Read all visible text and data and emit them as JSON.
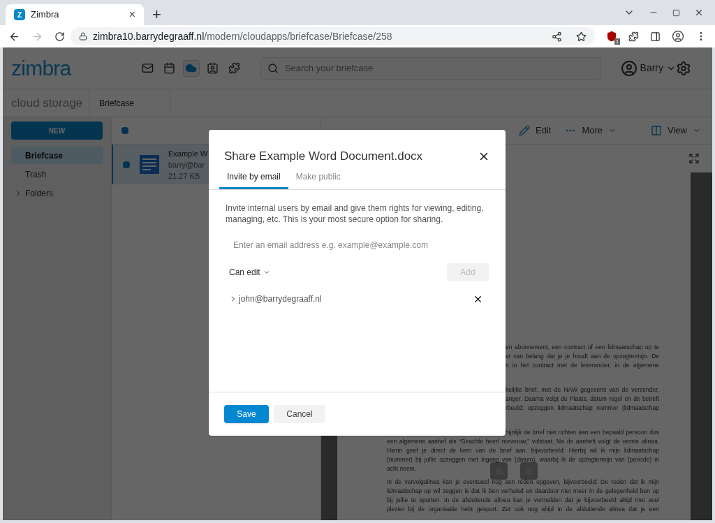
{
  "browser": {
    "tab": {
      "favicon_letter": "Z",
      "title": "Zimbra",
      "close": "×"
    },
    "new_tab": "+",
    "url_host": "zimbra10.barrydegraaff.nl",
    "url_path": "/modern/cloudapps/briefcase/Briefcase/258",
    "extension_badge": "1"
  },
  "app": {
    "logo": "zimbra",
    "nav_icons": [
      {
        "kind": "mail",
        "selected": false
      },
      {
        "kind": "calendar",
        "selected": false
      },
      {
        "kind": "cloud",
        "selected": true
      },
      {
        "kind": "contacts",
        "selected": false
      },
      {
        "kind": "apps",
        "selected": false
      }
    ],
    "search": {
      "placeholder": "Search your briefcase"
    },
    "user": "Barry",
    "section_title": "cloud storage",
    "breadcrumb": "Briefcase",
    "new_button": "NEW",
    "sidebar": [
      {
        "kind": "folder",
        "label": "Briefcase",
        "selected": true
      },
      {
        "kind": "folder",
        "label": "Trash",
        "selected": false
      },
      {
        "kind": "group",
        "label": "Folders",
        "expanded": false
      }
    ],
    "list": {
      "select_all": true,
      "items": [
        {
          "name": "Example W",
          "owner": "barry@bar",
          "size": "21.27 KB",
          "checked": true,
          "selected": true
        }
      ]
    },
    "toolbar": [
      {
        "kind": "edit",
        "label": "Edit"
      },
      {
        "kind": "more",
        "label": "More"
      },
      {
        "kind": "view",
        "label": "View"
      }
    ],
    "document": {
      "paragraphs": [
        {
          "cut_lines": [
            "en abonnement, een contract of een lidmaatschap op te",
            "et van belang dat je je houdt aan de opzegtermijn. De",
            "n in het contract met de leverancier, in de algemene"
          ]
        },
        {
          "cut_lines": [
            "kelijke brief, met de NAW gegevens van de verzender,",
            "anger. Daarna volgt de Plaats, datum regel en de betreft",
            "rbeeld: opzeggen lidmaatschap nummer (lidmaatschap"
          ]
        },
        {
          "cut_lines": [
            "hijnlijk de brief niet richten aan een bepaald persoon dus"
          ],
          "lines": [
            "een algemene aanhef als “Geachte heer/ mevrouw,” volstaat. Na de aanheft volgt de eerste alinea.",
            "Hierin geef je direct de kern van de brief aan, bijvoorbeeld: Hierbij wil ik mijn lidmaatschap",
            "(nummer) bij jullie opzeggen met ingang van (datum), waarbij ik de opzegtermijn van (periode) in",
            "acht neem."
          ]
        },
        {
          "lines": [
            "In de vervolgalinea kan je eventueel nog een reden opgeven, bijvoorbeeld: De reden dat ik mijn",
            "lidmaatschap op wil zeggen is dat ik ben verhuisd en daardoor niet meer in de gelegenheid ben op",
            "bij jullie te sporten. In de afsluitende alinea kan je vermelden dat je bijvoorbeeld altijd met veel",
            "plezier bij de organisatie hebt gesport. Zet ook nog altijd in de afsluitende alinea dat je een"
          ]
        }
      ]
    }
  },
  "dialog": {
    "title": "Share Example Word Document.docx",
    "tabs": [
      {
        "label": "Invite by email",
        "selected": true
      },
      {
        "label": "Make public",
        "selected": false
      }
    ],
    "description": "Invite internal users by email and give them rights for viewing, editing, managing, etc. This is your most secure option for sharing.",
    "email": {
      "placeholder": "Enter an email address e.g. example@example.com"
    },
    "permission": "Can edit",
    "add_button": {
      "label": "Add",
      "disabled": true
    },
    "recipients": [
      {
        "email": "john@barrydegraaff.nl",
        "expanded": false
      }
    ],
    "buttons": [
      {
        "kind": "primary",
        "label": "Save"
      },
      {
        "kind": "secondary",
        "label": "Cancel"
      }
    ]
  }
}
